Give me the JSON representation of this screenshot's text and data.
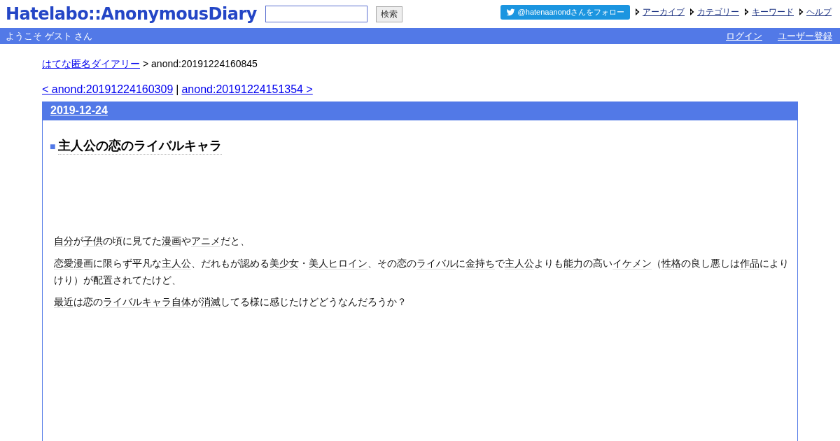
{
  "header": {
    "logo": "Hatelabo::AnonymousDiary",
    "search": {
      "button": "検索"
    },
    "follow_button": "@hatenaanondさんをフォロー",
    "nav": [
      "アーカイブ",
      "カテゴリー",
      "キーワード",
      "ヘルプ"
    ]
  },
  "user_bar": {
    "welcome": "ようこそ ゲスト さん",
    "links": [
      "ログイン",
      "ユーザー登録"
    ]
  },
  "breadcrumb": {
    "link": "はてな匿名ダイアリー",
    "current": "> anond:20191224160845"
  },
  "pager": {
    "prev": "< anond:20191224160309",
    "separator": "|",
    "next": "anond:20191224151354 >"
  },
  "day": {
    "date": "2019-12-24",
    "section_mark": "■",
    "title": "主人公の恋のライバルキャラ",
    "paragraphs": [
      [
        {
          "text": "自分",
          "keyword": true
        },
        {
          "text": "が",
          "keyword": false
        },
        {
          "text": "子供",
          "keyword": true
        },
        {
          "text": "の頃に見てた",
          "keyword": false
        },
        {
          "text": "漫画",
          "keyword": true
        },
        {
          "text": "や",
          "keyword": false
        },
        {
          "text": "アニメ",
          "keyword": true
        },
        {
          "text": "だと、",
          "keyword": false
        }
      ],
      [
        {
          "text": "恋愛漫画",
          "keyword": true
        },
        {
          "text": "に限らず平凡な",
          "keyword": false
        },
        {
          "text": "主人公",
          "keyword": true
        },
        {
          "text": "、だれもが認める",
          "keyword": false
        },
        {
          "text": "美少女",
          "keyword": true
        },
        {
          "text": "・",
          "keyword": false
        },
        {
          "text": "美人ヒロイン",
          "keyword": true
        },
        {
          "text": "、その恋の",
          "keyword": false
        },
        {
          "text": "ライバル",
          "keyword": true
        },
        {
          "text": "に",
          "keyword": false
        },
        {
          "text": "金持ち",
          "keyword": true
        },
        {
          "text": "で",
          "keyword": false
        },
        {
          "text": "主人公",
          "keyword": true
        },
        {
          "text": "よりも",
          "keyword": false
        },
        {
          "text": "能力",
          "keyword": true
        },
        {
          "text": "の高い",
          "keyword": false
        },
        {
          "text": "イケメン",
          "keyword": true
        },
        {
          "text": "（",
          "keyword": false
        },
        {
          "text": "性格",
          "keyword": true
        },
        {
          "text": "の良し悪しは",
          "keyword": false
        },
        {
          "text": "作品",
          "keyword": true
        },
        {
          "text": "によりけり）が配置されてたけど、",
          "keyword": false
        }
      ],
      [
        {
          "text": "最近",
          "keyword": true
        },
        {
          "text": "は恋の",
          "keyword": false
        },
        {
          "text": "ライバルキャラ",
          "keyword": true
        },
        {
          "text": "自体",
          "keyword": true
        },
        {
          "text": "が",
          "keyword": false
        },
        {
          "text": "消滅",
          "keyword": true
        },
        {
          "text": "してる様に感じたけどどうなんだろうか？",
          "keyword": false
        }
      ]
    ]
  }
}
